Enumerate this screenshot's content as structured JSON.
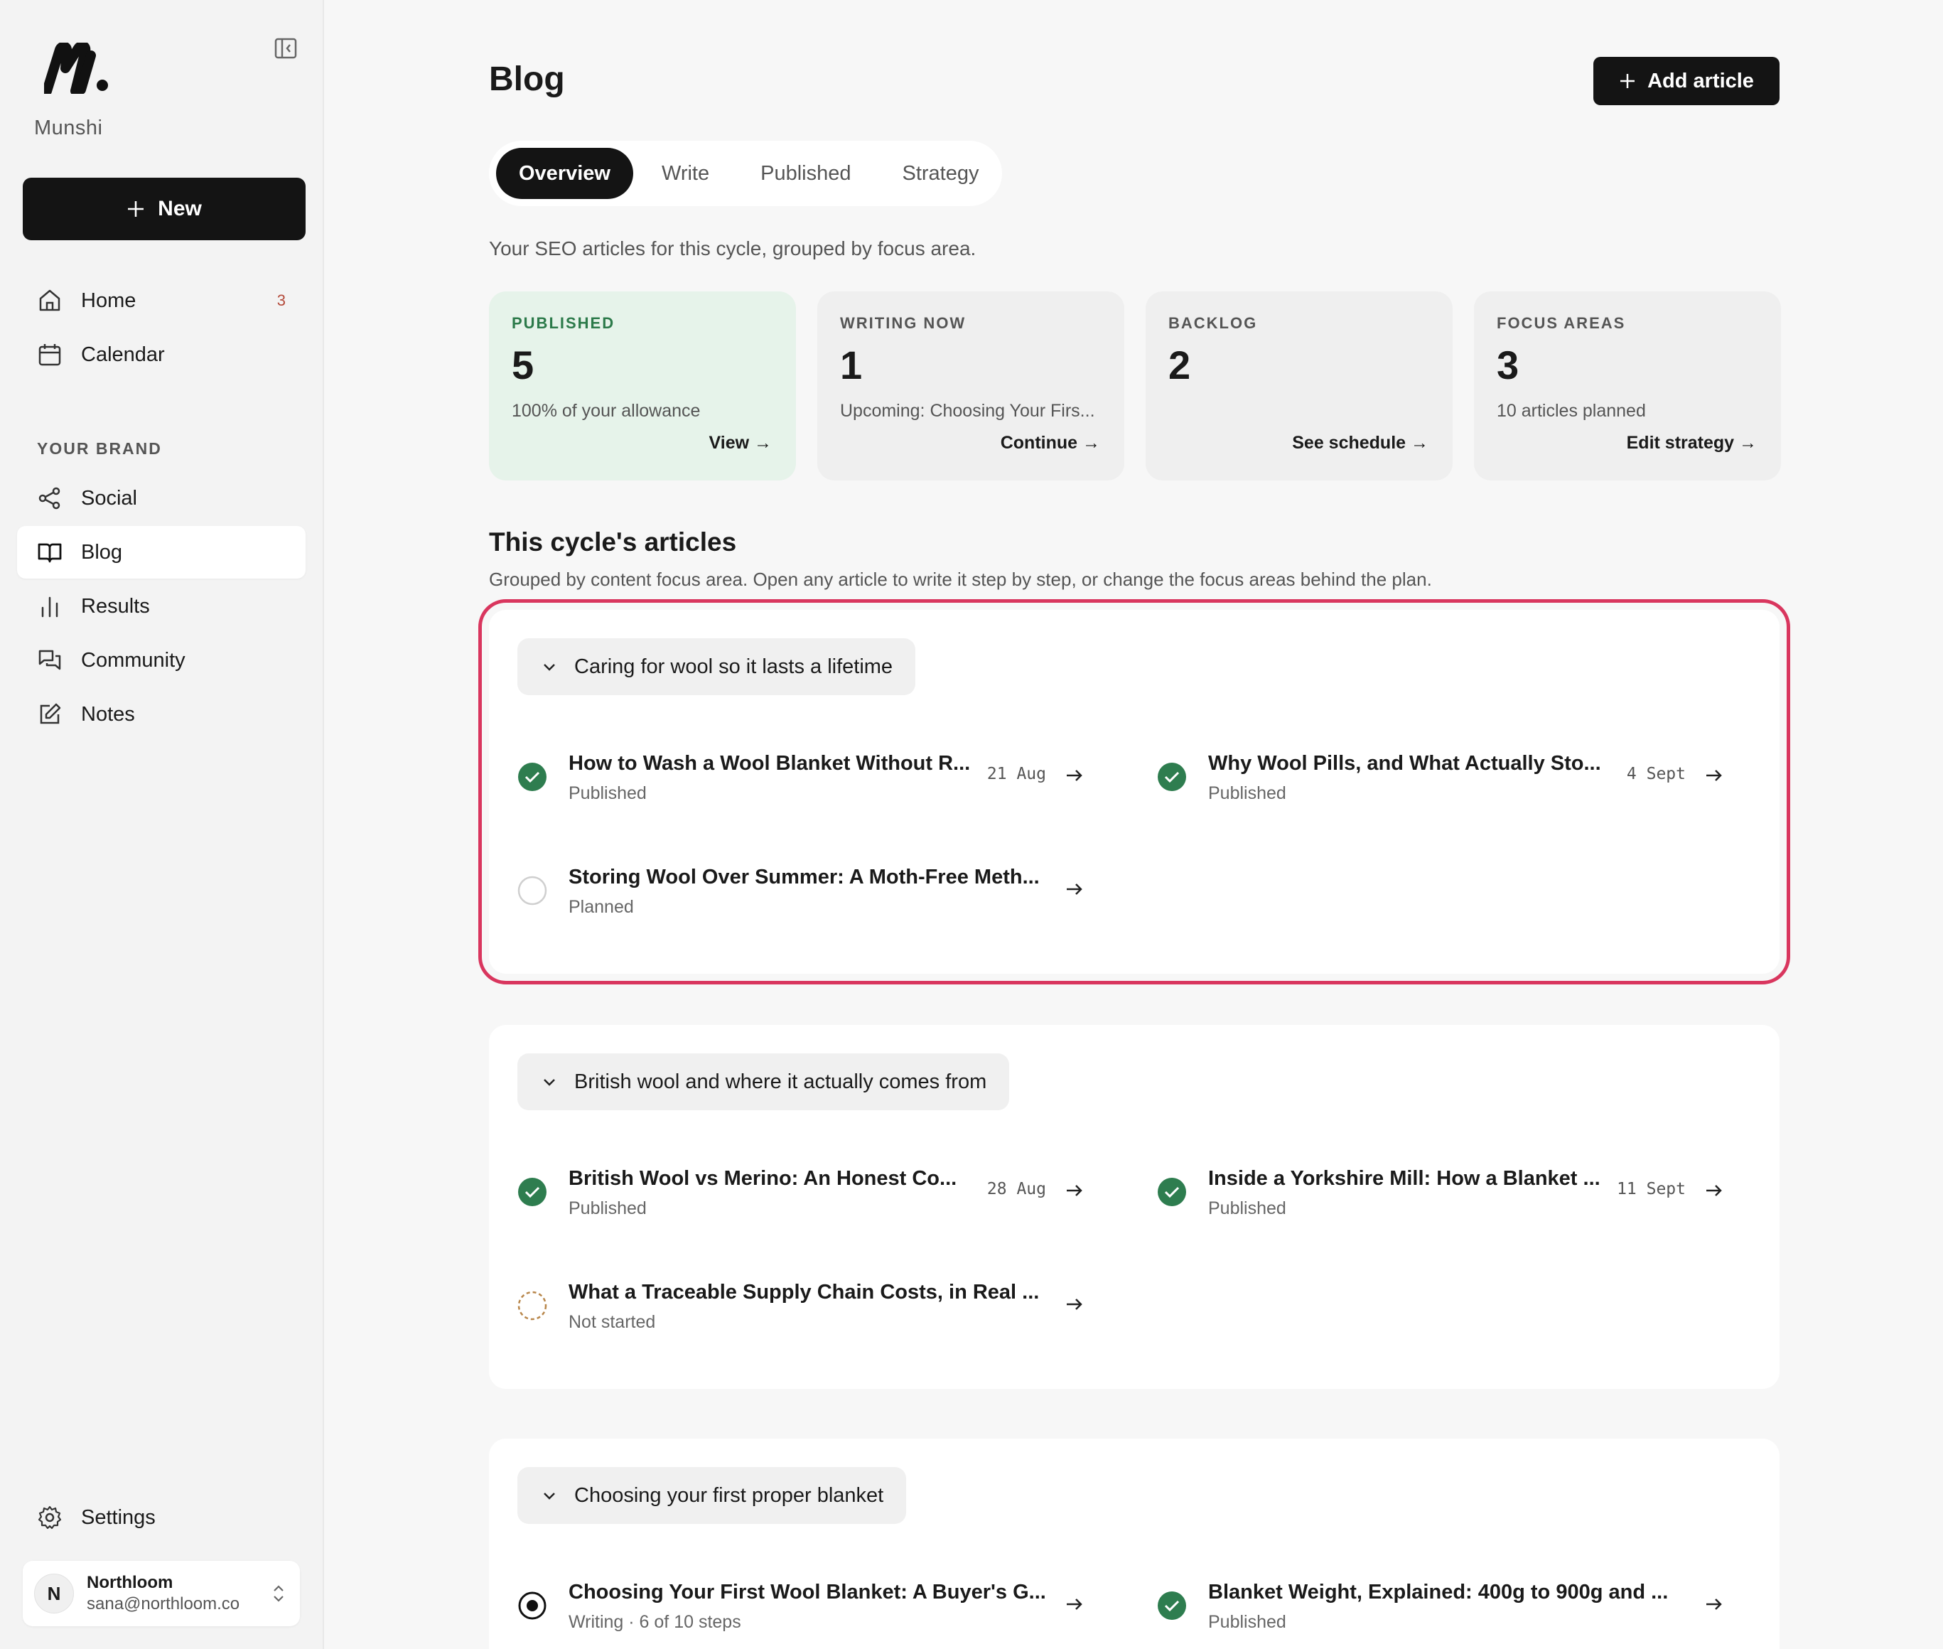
{
  "app": {
    "brand": "Munshi",
    "new_label": "New"
  },
  "sidebar": {
    "items": [
      {
        "label": "Home",
        "badge": "3",
        "icon": "home-icon"
      },
      {
        "label": "Calendar",
        "icon": "calendar-icon"
      }
    ],
    "section_label": "YOUR BRAND",
    "brand_items": [
      {
        "label": "Social",
        "icon": "share-icon"
      },
      {
        "label": "Blog",
        "icon": "book-icon"
      },
      {
        "label": "Results",
        "icon": "bar-chart-icon"
      },
      {
        "label": "Community",
        "icon": "chat-icon"
      },
      {
        "label": "Notes",
        "icon": "edit-icon"
      }
    ],
    "settings_label": "Settings",
    "account": {
      "initial": "N",
      "name": "Northloom",
      "email": "sana@northloom.co"
    }
  },
  "page": {
    "title": "Blog",
    "add_label": "Add article",
    "tabs": [
      "Overview",
      "Write",
      "Published",
      "Strategy"
    ],
    "active_tab": "Overview",
    "subtitle": "Your SEO articles for this cycle, grouped by focus area."
  },
  "stats": [
    {
      "label": "PUBLISHED",
      "value": "5",
      "desc": "100% of your allowance",
      "link": "View →"
    },
    {
      "label": "WRITING NOW",
      "value": "1",
      "desc": "Upcoming: Choosing Your Firs...",
      "link": "Continue →"
    },
    {
      "label": "BACKLOG",
      "value": "2",
      "desc": "",
      "link": "See schedule →"
    },
    {
      "label": "FOCUS AREAS",
      "value": "3",
      "desc": "10 articles planned",
      "link": "Edit strategy →"
    }
  ],
  "articles_section": {
    "title": "This cycle's articles",
    "subtitle": "Grouped by content focus area. Open any article to write it step by step, or change the focus areas behind the plan."
  },
  "groups": [
    {
      "name": "Caring for wool so it lasts a lifetime",
      "articles": [
        {
          "title": "How to Wash a Wool Blanket Without R...",
          "status": "Published",
          "date": "21 Aug",
          "state": "published"
        },
        {
          "title": "Why Wool Pills, and What Actually Sto...",
          "status": "Published",
          "date": "4 Sept",
          "state": "published"
        },
        {
          "title": "Storing Wool Over Summer: A Moth-Free Meth...",
          "status": "Planned",
          "date": "",
          "state": "planned"
        }
      ]
    },
    {
      "name": "British wool and where it actually comes from",
      "articles": [
        {
          "title": "British Wool vs Merino: An Honest Co...",
          "status": "Published",
          "date": "28 Aug",
          "state": "published"
        },
        {
          "title": "Inside a Yorkshire Mill: How a Blanket ...",
          "status": "Published",
          "date": "11 Sept",
          "state": "published"
        },
        {
          "title": "What a Traceable Supply Chain Costs, in Real ...",
          "status": "Not started",
          "date": "",
          "state": "not-started"
        }
      ]
    },
    {
      "name": "Choosing your first proper blanket",
      "articles": [
        {
          "title": "Choosing Your First Wool Blanket: A Buyer's G...",
          "status": "Writing · 6 of 10 steps",
          "date": "",
          "state": "writing"
        },
        {
          "title": "Blanket Weight, Explained: 400g to 900g and ...",
          "status": "Published",
          "date": "",
          "state": "published"
        }
      ]
    }
  ],
  "colors": {
    "accent": "#141414",
    "published_green": "#2e7d4f",
    "highlight_border": "#d9365e",
    "published_card_bg": "#e6f3ea"
  }
}
